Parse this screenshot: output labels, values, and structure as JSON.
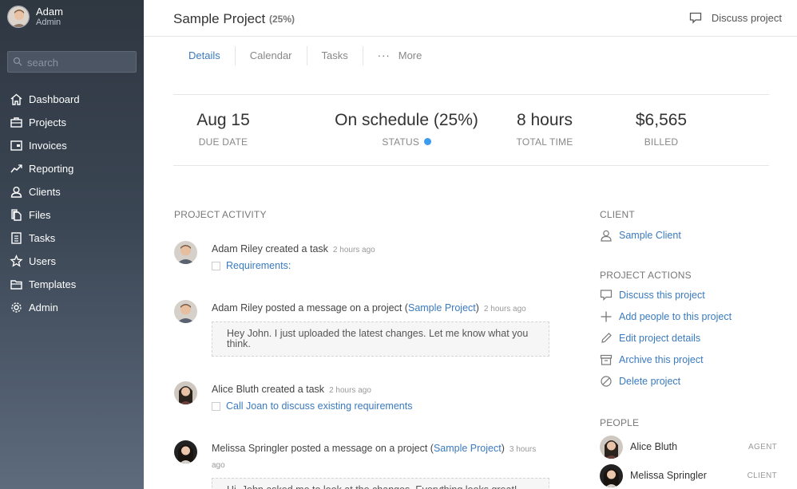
{
  "user": {
    "name": "Adam",
    "role": "Admin"
  },
  "search": {
    "placeholder": "search"
  },
  "sidebar": {
    "items": [
      {
        "label": "Dashboard",
        "icon": "home-icon"
      },
      {
        "label": "Projects",
        "icon": "briefcase-icon"
      },
      {
        "label": "Invoices",
        "icon": "invoice-icon"
      },
      {
        "label": "Reporting",
        "icon": "chart-icon"
      },
      {
        "label": "Clients",
        "icon": "user-icon"
      },
      {
        "label": "Files",
        "icon": "files-icon"
      },
      {
        "label": "Tasks",
        "icon": "tasks-icon"
      },
      {
        "label": "Users",
        "icon": "star-icon"
      },
      {
        "label": "Templates",
        "icon": "folder-icon"
      },
      {
        "label": "Admin",
        "icon": "gear-icon"
      }
    ]
  },
  "header": {
    "title": "Sample Project",
    "percent": "(25%)",
    "discuss_label": "Discuss project"
  },
  "tabs": [
    {
      "label": "Details",
      "active": true
    },
    {
      "label": "Calendar"
    },
    {
      "label": "Tasks"
    },
    {
      "label": "More",
      "prefix": "···"
    }
  ],
  "stats": [
    {
      "value": "Aug 15",
      "label": "DUE DATE"
    },
    {
      "value": "On schedule (25%)",
      "label": "STATUS",
      "status_color": "#3a9bef"
    },
    {
      "value": "8 hours",
      "label": "TOTAL TIME"
    },
    {
      "value": "$6,565",
      "label": "BILLED"
    }
  ],
  "activity": {
    "heading": "PROJECT ACTIVITY",
    "items": [
      {
        "who": "Adam Riley",
        "action": " created a task",
        "time": "2 hours ago",
        "task": "Requirements:"
      },
      {
        "who": "Adam Riley",
        "action": " posted a message on a project (",
        "link": "Sample Project",
        "action_end": ")",
        "time": "2 hours ago",
        "message": "Hey John. I just uploaded the latest changes. Let me know what you think."
      },
      {
        "who": "Alice Bluth",
        "action": " created a task",
        "time": "2 hours ago",
        "task": "Call Joan to discuss existing requirements"
      },
      {
        "who": "Melissa Springler",
        "action": " posted a message on a project (",
        "link": "Sample Project",
        "action_end": ")",
        "time": "3 hours ago",
        "message": "Hi, John asked me to look at the changes. Everything looks great!"
      }
    ]
  },
  "client": {
    "heading": "CLIENT",
    "name": "Sample Client"
  },
  "actions": {
    "heading": "PROJECT ACTIONS",
    "items": [
      {
        "label": "Discuss this project",
        "icon": "comment-icon"
      },
      {
        "label": "Add people to this project",
        "icon": "plus-icon"
      },
      {
        "label": "Edit project details",
        "icon": "pencil-icon"
      },
      {
        "label": "Archive this project",
        "icon": "archive-icon"
      },
      {
        "label": "Delete project",
        "icon": "ban-icon"
      }
    ]
  },
  "people": {
    "heading": "PEOPLE",
    "items": [
      {
        "name": "Alice Bluth",
        "role": "AGENT"
      },
      {
        "name": "Melissa Springler",
        "role": "CLIENT"
      }
    ]
  }
}
